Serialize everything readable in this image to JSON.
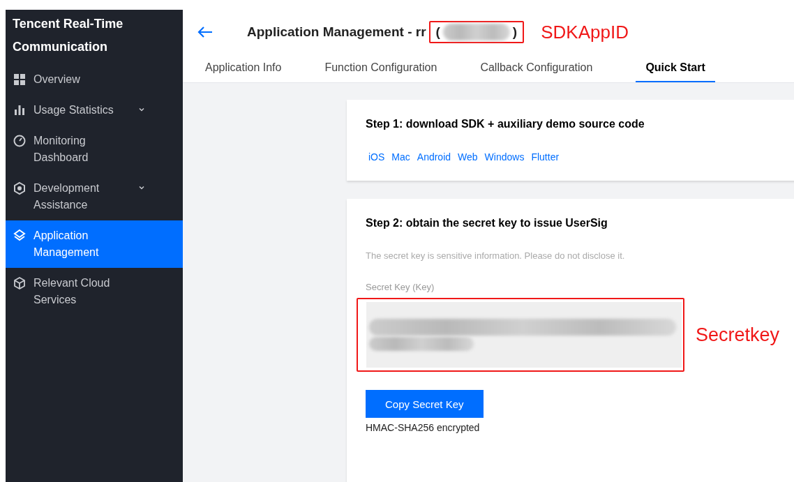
{
  "sidebar": {
    "title": "Tencent Real-Time Communication",
    "items": [
      {
        "label": "Overview",
        "expandable": false,
        "selected": false
      },
      {
        "label": "Usage Statistics",
        "expandable": true,
        "selected": false
      },
      {
        "label": "Monitoring Dashboard",
        "expandable": false,
        "selected": false
      },
      {
        "label": "Development Assistance",
        "expandable": true,
        "selected": false
      },
      {
        "label": "Application Management",
        "expandable": false,
        "selected": true
      },
      {
        "label": "Relevant Cloud Services",
        "expandable": false,
        "selected": false
      }
    ]
  },
  "header": {
    "title": "Application Management - rr",
    "app_id": {
      "open": "(",
      "close": ")"
    },
    "annotation": "SDKAppID"
  },
  "tabs": [
    {
      "label": "Application Info",
      "selected": false
    },
    {
      "label": "Function Configuration",
      "selected": false
    },
    {
      "label": "Callback Configuration",
      "selected": false
    },
    {
      "label": "Quick Start",
      "selected": true
    }
  ],
  "step1": {
    "title": "Step 1: download SDK + auxiliary demo source code",
    "links": [
      "iOS",
      "Mac",
      "Android",
      "Web",
      "Windows",
      "Flutter"
    ]
  },
  "step2": {
    "title": "Step 2: obtain the secret key to issue UserSig",
    "notice": "The secret key is sensitive information. Please do not disclose it.",
    "field_label": "Secret Key (Key)",
    "annotation": "Secretkey",
    "button": "Copy Secret Key",
    "note": "HMAC-SHA256 encrypted"
  }
}
